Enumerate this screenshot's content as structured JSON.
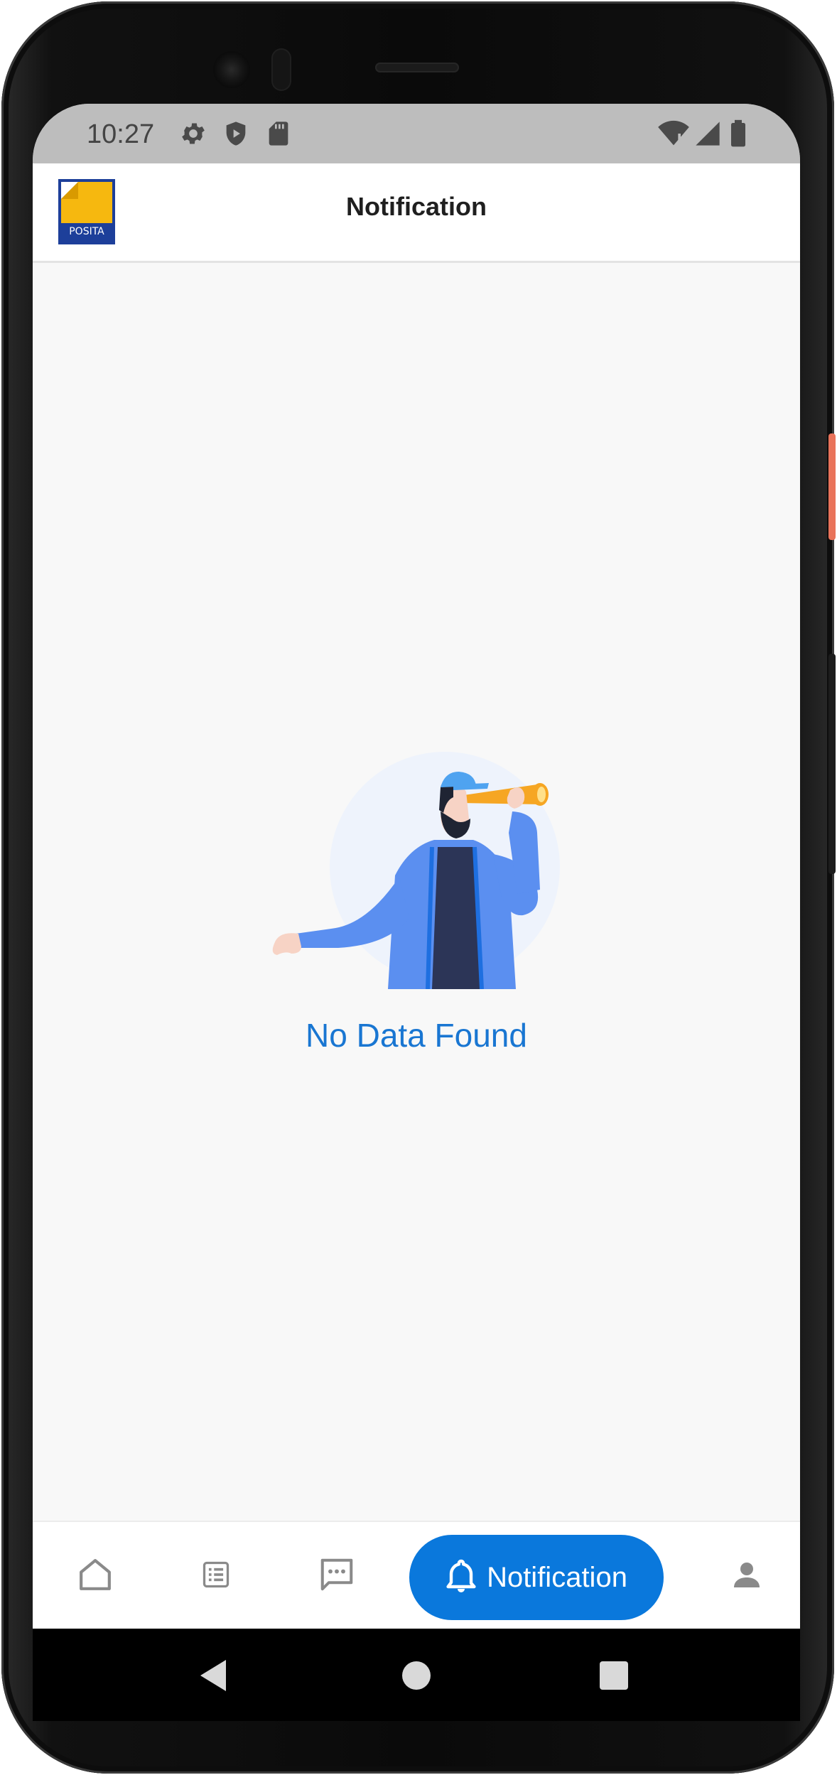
{
  "status_bar": {
    "time": "10:27",
    "left_icons": [
      "settings-icon",
      "shield-play-icon",
      "sd-card-icon"
    ],
    "right_icons": [
      "wifi-alert-icon",
      "cellular-signal-icon",
      "battery-icon"
    ]
  },
  "app_bar": {
    "logo_text": "POSITA",
    "title": "Notification"
  },
  "empty_state": {
    "message": "No Data Found",
    "illustration": "person-with-telescope"
  },
  "bottom_nav": {
    "items": [
      {
        "id": "home",
        "icon": "home-icon"
      },
      {
        "id": "list",
        "icon": "list-icon"
      },
      {
        "id": "chat",
        "icon": "chat-icon"
      },
      {
        "id": "notification",
        "icon": "bell-icon",
        "label": "Notification",
        "active": true
      },
      {
        "id": "profile",
        "icon": "person-icon"
      }
    ]
  },
  "system_nav": [
    "back-icon",
    "home-circle-icon",
    "recents-icon"
  ],
  "colors": {
    "accent": "#0a78dc",
    "empty_text": "#1976d2",
    "status_bar_bg": "#bdbdbd",
    "content_bg": "#f8f8f8"
  }
}
